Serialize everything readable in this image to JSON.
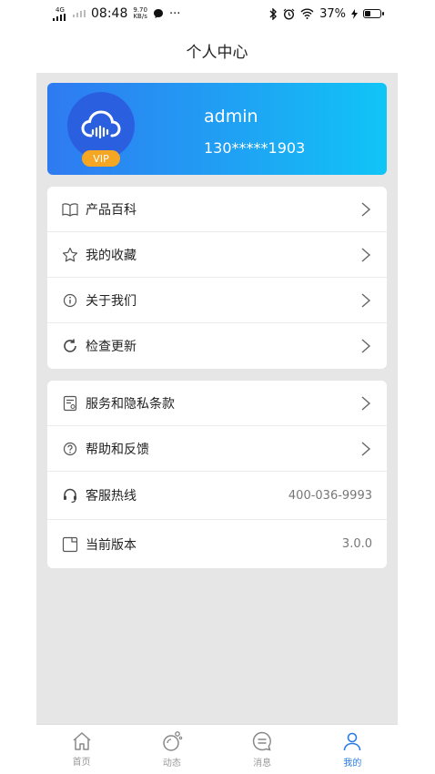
{
  "status": {
    "network": "4G",
    "time": "08:48",
    "speed_value": "9.70",
    "speed_unit": "KB/s",
    "more": "···",
    "battery": "37%"
  },
  "title": "个人中心",
  "profile": {
    "username": "admin",
    "phone": "130*****1903",
    "vip": "VIP",
    "avatar_icon": "cloud-icon",
    "colors": {
      "card_start": "#2f7af1",
      "card_end": "#10c5f6",
      "vip": "#f5a623"
    }
  },
  "menu1": [
    {
      "label": "产品百科",
      "icon": "book-icon"
    },
    {
      "label": "我的收藏",
      "icon": "star-icon"
    },
    {
      "label": "关于我们",
      "icon": "info-icon"
    },
    {
      "label": "检查更新",
      "icon": "refresh-icon"
    }
  ],
  "menu2": [
    {
      "label": "服务和隐私条款",
      "icon": "document-icon"
    },
    {
      "label": "帮助和反馈",
      "icon": "help-icon"
    },
    {
      "label": "客服热线",
      "icon": "headset-icon",
      "value": "400-036-9993"
    },
    {
      "label": "当前版本",
      "icon": "version-icon",
      "value": "3.0.0"
    }
  ],
  "tabs": [
    {
      "label": "首页",
      "icon": "home-icon"
    },
    {
      "label": "动态",
      "icon": "dynamic-icon"
    },
    {
      "label": "消息",
      "icon": "message-icon"
    },
    {
      "label": "我的",
      "icon": "user-icon",
      "active": true
    }
  ],
  "accent": "#2a7be6"
}
